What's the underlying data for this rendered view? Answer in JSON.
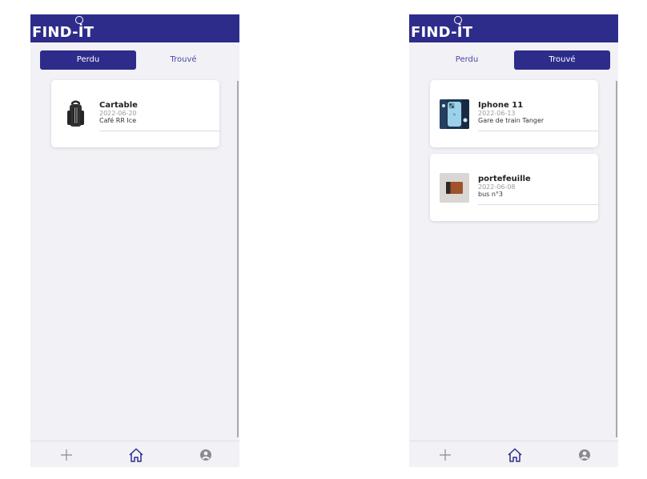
{
  "app": {
    "logo_text": "FIND-İT",
    "brand_color": "#2e2c8a",
    "background_color": "#f1f1f6"
  },
  "screens": [
    {
      "tabs": [
        {
          "label": "Perdu",
          "active": true
        },
        {
          "label": "Trouvé",
          "active": false
        }
      ],
      "items": [
        {
          "title": "Cartable",
          "date": "2022-06-20",
          "place": "Café RR Ice",
          "image": "backpack-image"
        }
      ]
    },
    {
      "tabs": [
        {
          "label": "Perdu",
          "active": false
        },
        {
          "label": "Trouvé",
          "active": true
        }
      ],
      "items": [
        {
          "title": "Iphone 11",
          "date": "2022-06-13",
          "place": "Gare de train Tanger",
          "image": "iphone-image"
        },
        {
          "title": "portefeuille",
          "date": "2022-06-08",
          "place": "bus n°3",
          "image": "wallet-image"
        }
      ]
    }
  ],
  "bottom_nav": {
    "items": [
      {
        "icon": "plus-icon"
      },
      {
        "icon": "home-icon",
        "active": true
      },
      {
        "icon": "user-circle-icon"
      }
    ]
  }
}
